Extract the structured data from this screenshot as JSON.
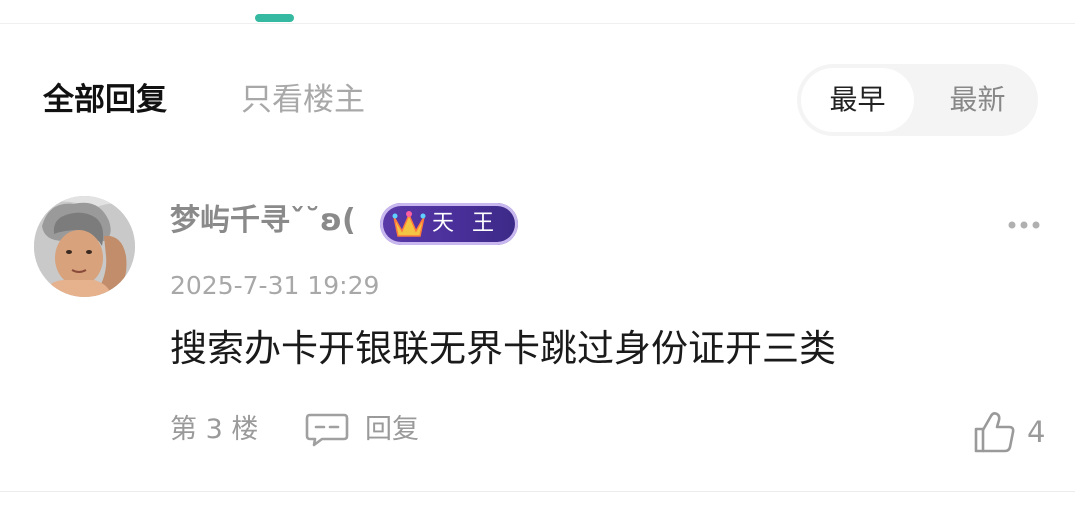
{
  "filters": {
    "all_replies": "全部回复",
    "op_only": "只看楼主"
  },
  "sort": {
    "earliest": "最早",
    "latest": "最新"
  },
  "post": {
    "username": "梦屿千寻ˇ˘ʚ(",
    "badge_text": "天王",
    "timestamp": "2025-7-31 19:29",
    "content": "搜索办卡开银联无界卡跳过身份证开三类",
    "floor": "第 3 楼",
    "reply_label": "回复",
    "like_count": "4"
  },
  "colors": {
    "accent": "#35b9a0",
    "badge_purple": "#4a2f9a"
  },
  "icons": {
    "more": "more-dots-icon",
    "reply": "comment-bubble-icon",
    "like": "thumbs-up-icon",
    "badge": "crown-icon"
  }
}
